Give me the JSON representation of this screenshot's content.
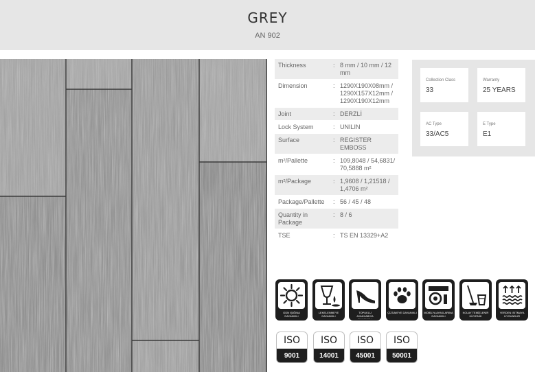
{
  "product": {
    "name": "GREY",
    "code": "AN 902"
  },
  "specs": [
    {
      "label": "Thickness",
      "value": "8 mm / 10 mm / 12 mm"
    },
    {
      "label": "Dimension",
      "value": "1290X190X08mm / 1290X157X12mm / 1290X190X12mm"
    },
    {
      "label": "Joint",
      "value": "DERZLİ"
    },
    {
      "label": "Lock System",
      "value": "UNILIN"
    },
    {
      "label": "Surface",
      "value": "REGISTER EMBOSS"
    },
    {
      "label": "m²/Pallette",
      "value": "109,8048 / 54,6831/ 70,5888 m²"
    },
    {
      "label": "m²/Package",
      "value": "1,9608 / 1,21518 / 1,4706 m²"
    },
    {
      "label": "Package/Pallette",
      "value": "56 / 45 / 48"
    },
    {
      "label": "Quantity in Package",
      "value": "8 / 6"
    },
    {
      "label": "TSE",
      "value": "TS EN 13329+A2"
    }
  ],
  "cards": [
    {
      "label": "Collection Class",
      "value": "33"
    },
    {
      "label": "Warranty",
      "value": "25 YEARS"
    },
    {
      "label": "AC Type",
      "value": "33/AC5"
    },
    {
      "label": "E Type",
      "value": "E1"
    }
  ],
  "badges": [
    {
      "icon": "sun-icon",
      "caption": "GÜN IŞIĞINA DAYANIKLI"
    },
    {
      "icon": "spill-icon",
      "caption": "LEKELENMEYE DAYANIKLI"
    },
    {
      "icon": "high-heel-icon",
      "caption": "TOPUKLU AYAKKABIYA DAYANIKLI"
    },
    {
      "icon": "paw-icon",
      "caption": "ÇİZİLMEYE DAYANIKLI"
    },
    {
      "icon": "chair-wheel-icon",
      "caption": "MOBİLYA AYAKLARINA DAYANIKLI"
    },
    {
      "icon": "mop-bucket-icon",
      "caption": "KOLAY TEMİZLENİR HİJYENİK"
    },
    {
      "icon": "underfloor-heating-icon",
      "caption": "YERDEN ISITMAYA UYGUNDUR"
    }
  ],
  "certificates": [
    {
      "title": "ISO",
      "number": "9001"
    },
    {
      "title": "ISO",
      "number": "14001"
    },
    {
      "title": "ISO",
      "number": "45001"
    },
    {
      "title": "ISO",
      "number": "50001"
    }
  ]
}
